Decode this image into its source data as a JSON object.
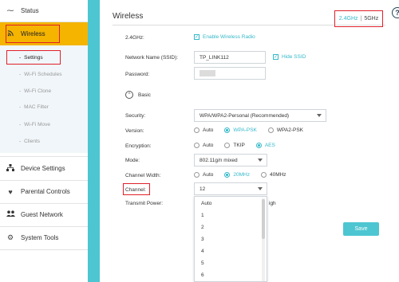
{
  "colors": {
    "accent": "#35b8c8",
    "teal": "#4dc6d1",
    "active_nav": "#f4b400",
    "highlight": "#e0202a"
  },
  "sidebar": {
    "status": {
      "label": "Status",
      "icon": "pulse-icon"
    },
    "wireless": {
      "label": "Wireless",
      "icon": "wifi-icon"
    },
    "sub_items": [
      "Settings",
      "Wi-Fi Schedules",
      "Wi-Fi Clone",
      "MAC Filter",
      "Wi-Fi Move",
      "Clients"
    ],
    "device_settings": {
      "label": "Device Settings",
      "icon": "sitemap-icon"
    },
    "parental_controls": {
      "label": "Parental Controls",
      "icon": "heart-icon"
    },
    "guest_network": {
      "label": "Guest Network",
      "icon": "users-icon"
    },
    "system_tools": {
      "label": "System Tools",
      "icon": "gear-icon"
    }
  },
  "main": {
    "title": "Wireless",
    "band_24": "2.4GHz",
    "band_sep": "|",
    "band_5": "5GHz",
    "help": "?",
    "section_label": "2.4GHz:",
    "enable_wireless": "Enable Wireless Radio",
    "ssid_label": "Network Name (SSID):",
    "ssid_value": "TP_LINK112",
    "hide_ssid": "Hide SSID",
    "password_label": "Password:",
    "basic_label": "Basic",
    "security_label": "Security:",
    "security_value": "WPA/WPA2-Personal (Recommended)",
    "version_label": "Version:",
    "version_options": [
      "Auto",
      "WPA-PSK",
      "WPA2-PSK"
    ],
    "encryption_label": "Encryption:",
    "encryption_options": [
      "Auto",
      "TKIP",
      "AES"
    ],
    "mode_label": "Mode:",
    "mode_value": "802.11g/n mixed",
    "channel_width_label": "Channel Width:",
    "channel_width_options": [
      "Auto",
      "20MHz",
      "40MHz"
    ],
    "channel_label": "Channel:",
    "channel_value": "12",
    "tx_power_label": "Transmit Power:",
    "tx_power_partial": "igh",
    "channel_options": [
      "Auto",
      "1",
      "2",
      "3",
      "4",
      "5",
      "6"
    ],
    "save_label": "Save"
  }
}
